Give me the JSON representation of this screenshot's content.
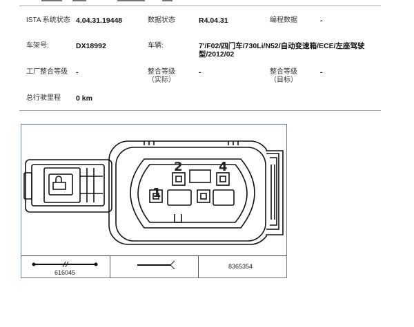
{
  "header": {
    "ista_label": "ISTA 系统状态",
    "ista_value": "4.04.31.19448",
    "data_status_label": "数据状态",
    "data_status_value": "R4.04.31",
    "programming_label": "编程数据",
    "programming_value": "-",
    "chassis_label": "车架号:",
    "chassis_value": "DX18992",
    "vehicle_label": "车辆:",
    "vehicle_value": "7'/F02/四门车/730Li/N52/自动变速箱/ECE/左座驾驶型/2012/02",
    "factory_label": "工厂整合等级",
    "factory_value": "-",
    "actual_label": "整合等级\n（实际）",
    "actual_value": "-",
    "target_label": "整合等级\n（目标）",
    "target_value": "-",
    "mileage_label": "总行驶里程",
    "mileage_value": "0 km"
  },
  "connector": {
    "pins": [
      "1",
      "2",
      "4"
    ]
  },
  "legend": {
    "cable_part": "616045",
    "part_number": "8365354"
  }
}
